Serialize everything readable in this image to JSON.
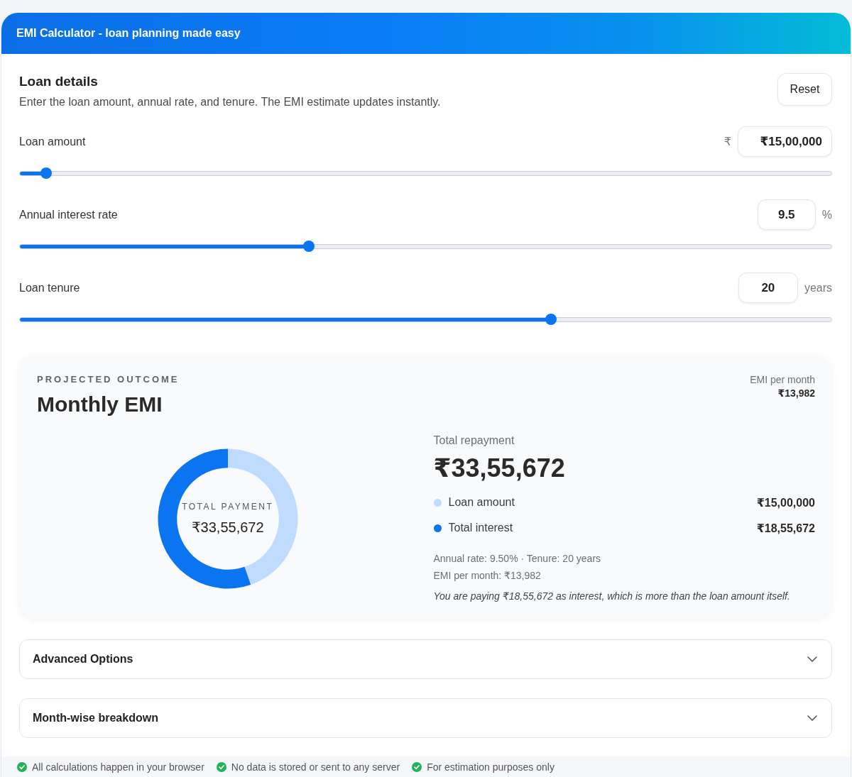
{
  "header": {
    "title": "EMI Calculator - loan planning made easy"
  },
  "loan_details": {
    "title": "Loan details",
    "subtitle": "Enter the loan amount, annual rate, and tenure. The EMI estimate updates instantly.",
    "reset_button": "Reset",
    "inputs": [
      {
        "label": "Loan amount",
        "prefix": "₹",
        "value": "₹15,00,000",
        "level": 0.033
      },
      {
        "label": "Annual interest rate",
        "value": "9.5",
        "suffix": "%",
        "level": 0.356
      },
      {
        "label": "Loan tenure",
        "value": "20",
        "suffix": "years",
        "level": 0.654
      }
    ]
  },
  "outcome": {
    "eyebrow": "PROJECTED OUTCOME",
    "title": "Monthly EMI",
    "emi_label": "EMI per month",
    "emi_value": "₹13,982",
    "donut": {
      "center_label": "TOTAL PAYMENT",
      "center_value": "₹33,55,672",
      "chart_data": {
        "type": "donut",
        "categories": [
          "Loan amount",
          "Total interest"
        ],
        "values": [
          44.7,
          55.3
        ]
      }
    },
    "total_label": "Total repayment",
    "total_value": "₹33,55,672",
    "legend": [
      {
        "value": "₹15,00,000",
        "color": "#bfdbfe"
      },
      {
        "value": "₹18,55,672",
        "color": "#0b74f0"
      }
    ],
    "summary": [
      "Annual rate: 9.50% · Tenure: 20 years",
      "EMI per month: ₹13,982"
    ],
    "note": "You are paying ₹18,55,672 as interest, which is more than the loan amount itself."
  },
  "sections": [
    {
      "title": "Advanced Options",
      "expanded": false
    },
    {
      "title": "Month-wise breakdown",
      "expanded": false
    }
  ],
  "footer": [
    "All calculations happen in your browser",
    "No data is stored or sent to any server",
    "For estimation purposes only"
  ]
}
